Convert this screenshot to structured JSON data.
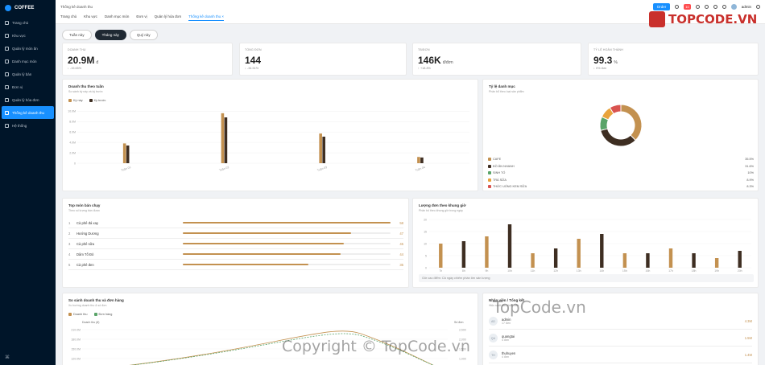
{
  "app": {
    "name": "COFFEE"
  },
  "sidebar": {
    "items": [
      {
        "label": "Trang chủ",
        "icon": "home-icon"
      },
      {
        "label": "Khu vực",
        "icon": "send-icon"
      },
      {
        "label": "Quản lý món ăn",
        "icon": "dish-icon"
      },
      {
        "label": "Danh mục món",
        "icon": "list-icon"
      },
      {
        "label": "Quản lý bàn",
        "icon": "table-icon"
      },
      {
        "label": "Đơn vị",
        "icon": "unit-icon"
      },
      {
        "label": "Quản lý hóa đơn",
        "icon": "invoice-icon"
      },
      {
        "label": "Thống kê doanh thu",
        "icon": "chart-icon"
      },
      {
        "label": "Hệ thống",
        "icon": "gear-icon"
      }
    ],
    "active_index": 7,
    "footer_icon": "collapse-icon"
  },
  "header": {
    "breadcrumb": "Thống kê doanh thu",
    "tabs": [
      "Trang chủ",
      "Khu vực",
      "Danh mục món",
      "Đơn vị",
      "Quản lý hóa đơn",
      "Thống kê doanh thu ×"
    ],
    "active_tab": 5,
    "order_button": "Order",
    "badge": "10",
    "user": "admin"
  },
  "watermark": {
    "logo_text": "TOPCODE.VN",
    "center": "TopCode.vn",
    "bottom": "Copyright © TopCode.vn"
  },
  "periods": {
    "items": [
      "Tuần này",
      "Tháng này",
      "Quý này"
    ],
    "active": 1
  },
  "stats": [
    {
      "label": "Doanh thu",
      "value": "20.9M",
      "unit": "đ",
      "change": "↓ -15.65%"
    },
    {
      "label": "Tổng đơn",
      "value": "144",
      "unit": "",
      "change": "↓ -34.51%"
    },
    {
      "label": "TB/đơn",
      "value": "146K",
      "unit": "đ/đơn",
      "change": "↑ +18.8%"
    },
    {
      "label": "Tỷ lệ hoàn thành",
      "value": "99.3",
      "unit": "%",
      "change": "↓ 0% đơn"
    }
  ],
  "revenue_week": {
    "title": "Doanh thu theo tuần",
    "subtitle": "So sánh kỳ này và kỳ trước",
    "legend": [
      "Kỳ này",
      "Kỳ trước"
    ],
    "colors": {
      "current": "#c39150",
      "previous": "#3e2e22"
    },
    "chart_data": {
      "type": "bar",
      "categories": [
        "Tuần 01",
        "Tuần 02",
        "Tuần 03",
        "Tuần 04"
      ],
      "series": [
        {
          "name": "Kỳ này",
          "values": [
            3.8,
            9.6,
            5.7,
            1.2
          ]
        },
        {
          "name": "Kỳ trước",
          "values": [
            3.4,
            8.8,
            5.1,
            1.1
          ]
        }
      ],
      "yticks": [
        "10.0M",
        "8.0M",
        "6.0M",
        "4.0M",
        "2.0M",
        "0"
      ],
      "ylim": [
        0,
        10.5
      ]
    }
  },
  "category_share": {
    "title": "Tỷ lệ danh mục",
    "subtitle": "Phân bổ theo loại sản phẩm",
    "chart_data": {
      "type": "pie",
      "labels": [
        "CAFE",
        "ĐỒ ĂN NHANH",
        "SINH TỐ",
        "TRÀ SỮA",
        "THỨC UỐNG KEM SỮA"
      ],
      "values": [
        35.5,
        31.6,
        10,
        8.9,
        8.3
      ],
      "display": [
        "35.5%",
        "31.6%",
        "10%",
        "8.9%",
        "8.3%"
      ],
      "colors": [
        "#c39150",
        "#3e2e22",
        "#5aa469",
        "#e8a33c",
        "#d9534f"
      ]
    }
  },
  "top_items": {
    "title": "Top món bán chạy",
    "subtitle": "Theo số lượng bán được",
    "rows": [
      {
        "rank": "1",
        "name": "Cà phê đá xay",
        "qty": "58"
      },
      {
        "rank": "2",
        "name": "Hướng Dương",
        "qty": "47"
      },
      {
        "rank": "3",
        "name": "Cà phê sữa",
        "qty": "45"
      },
      {
        "rank": "4",
        "name": "Dâm Tố Đỏ",
        "qty": "44"
      },
      {
        "rank": "5",
        "name": "Cà phê đen",
        "qty": "35"
      }
    ],
    "max": 58
  },
  "hourly": {
    "title": "Lượng đơn theo khung giờ",
    "subtitle": "Phân bố theo khung giờ trong ngày",
    "note": "Giờ cao điểm: Cả ngày chiếm phần lớn sản lượng",
    "chart_data": {
      "type": "bar",
      "categories": [
        "7h",
        "8h",
        "9h",
        "10h",
        "11h",
        "12h",
        "13h",
        "14h",
        "15h",
        "16h",
        "17h",
        "18h",
        "19h",
        "20h"
      ],
      "values": [
        10,
        11,
        13,
        18,
        6,
        8,
        12,
        14,
        6,
        6,
        8,
        6,
        4,
        7
      ],
      "colors": [
        "#c39150",
        "#3e2e22"
      ],
      "yticks": [
        "20",
        "15",
        "10",
        "5",
        "0"
      ],
      "ylim": [
        0,
        20
      ]
    }
  },
  "compare": {
    "title": "So sánh doanh thu và đơn hàng",
    "subtitle": "Xu hướng doanh thu & số đơn",
    "legend": [
      "Doanh thu",
      "Đơn hàng"
    ],
    "left_axis_title": "Doanh thu (đ)",
    "right_axis_title": "Số đơn",
    "chart_data": {
      "type": "line",
      "yticks_left": [
        "210.0M",
        "180.0M",
        "150.0M",
        "120.0M",
        "90.0M"
      ],
      "yticks_right": [
        "2,500",
        "2,000",
        "1,500",
        "1,000"
      ]
    }
  },
  "staff": {
    "title": "Nhân viên / Tổng kết",
    "subtitle": "Hiệu suất các nhân viên",
    "rows": [
      {
        "initials": "AD",
        "name": "admin",
        "orders": "17 đơn",
        "revenue": "4.3M"
      },
      {
        "initials": "QU",
        "name": "quangtai",
        "orders": "4 đơn",
        "revenue": "1.5M"
      },
      {
        "initials": "TH",
        "name": "thuhuyen",
        "orders": "4 đơn",
        "revenue": "1.4M"
      }
    ]
  }
}
